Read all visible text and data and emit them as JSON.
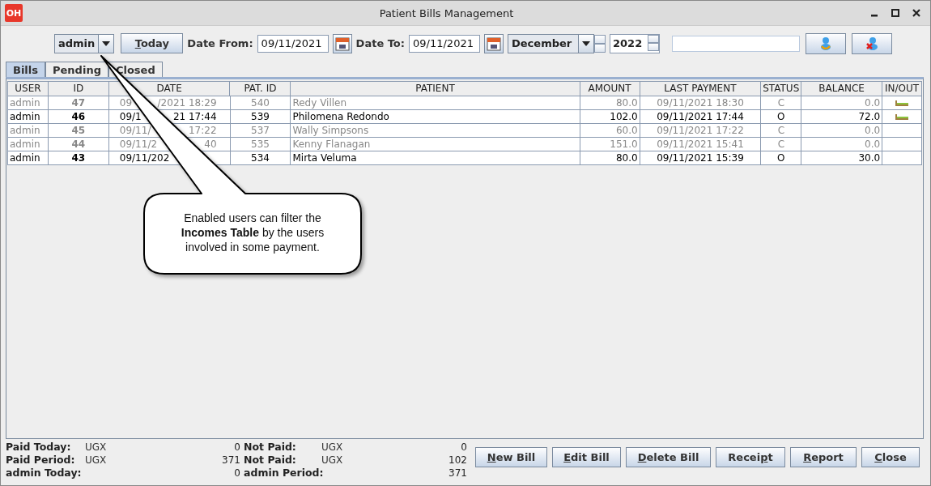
{
  "window": {
    "title": "Patient Bills Management",
    "logo": "OH"
  },
  "toolbar": {
    "user": "admin",
    "today_button": {
      "underlined": "T",
      "after": "oday"
    },
    "date_from_label": "Date From:",
    "date_from": "09/11/2021",
    "date_to_label": "Date To:",
    "date_to": "09/11/2021",
    "month": "December",
    "year": "2022"
  },
  "tabs": [
    {
      "label": "Bills",
      "selected": true
    },
    {
      "label": "Pending",
      "selected": false
    },
    {
      "label": "Closed",
      "selected": false
    }
  ],
  "table": {
    "columns": [
      "USER",
      "ID",
      "DATE",
      "PAT. ID",
      "PATIENT",
      "AMOUNT",
      "LAST PAYMENT",
      "STATUS",
      "BALANCE",
      "IN/OUT"
    ],
    "rows": [
      {
        "user": "admin",
        "id": "47",
        "date": "09",
        "date_tail": "/2021 18:29",
        "pat_id": "540",
        "patient": "Redy Villen",
        "amount": "80.0",
        "last_payment": "09/11/2021 18:30",
        "status": "C",
        "balance": "0.0",
        "in_out_icon": true,
        "greyed": true
      },
      {
        "user": "admin",
        "id": "46",
        "date": "09/1",
        "date_tail": "21 17:44",
        "pat_id": "539",
        "patient": "Philomena Redondo",
        "amount": "102.0",
        "last_payment": "09/11/2021 17:44",
        "status": "O",
        "balance": "72.0",
        "in_out_icon": true,
        "greyed": false
      },
      {
        "user": "admin",
        "id": "45",
        "date": "09/11/",
        "date_tail": "17:22",
        "pat_id": "537",
        "patient": "Wally Simpsons",
        "amount": "60.0",
        "last_payment": "09/11/2021 17:22",
        "status": "C",
        "balance": "0.0",
        "in_out_icon": false,
        "greyed": true
      },
      {
        "user": "admin",
        "id": "44",
        "date": "09/11/2",
        "date_tail": "40",
        "pat_id": "535",
        "patient": "Kenny Flanagan",
        "amount": "151.0",
        "last_payment": "09/11/2021 15:41",
        "status": "C",
        "balance": "0.0",
        "in_out_icon": false,
        "greyed": true
      },
      {
        "user": "admin",
        "id": "43",
        "date": "09/11/202",
        "pat_id": "534",
        "patient": "Mirta Veluma",
        "amount": "80.0",
        "last_payment": "09/11/2021 15:39",
        "status": "O",
        "balance": "30.0",
        "in_out_icon": false,
        "greyed": false
      }
    ]
  },
  "callout": "Enabled users can filter the **Incomes Table** by the users involved in some payment.",
  "summary": [
    {
      "label": "Paid Today:",
      "currency": "UGX",
      "value": "0",
      "label2": "Not Paid:",
      "currency2": "UGX",
      "value2": "0"
    },
    {
      "label": "Paid Period:",
      "currency": "UGX",
      "value": "371",
      "label2": "Not Paid:",
      "currency2": "UGX",
      "value2": "102"
    },
    {
      "label": "admin Today:",
      "value": "0",
      "label2": "admin Period:",
      "value2": "371"
    }
  ],
  "buttons": [
    {
      "underlined": "N",
      "after": "ew Bill"
    },
    {
      "underlined": "E",
      "after": "dit Bill"
    },
    {
      "underlined": "D",
      "after": "elete Bill"
    },
    {
      "before": "Recei",
      "underlined": "p",
      "after": "t"
    },
    {
      "underlined": "R",
      "after": "eport"
    },
    {
      "underlined": "C",
      "after": "lose"
    }
  ]
}
